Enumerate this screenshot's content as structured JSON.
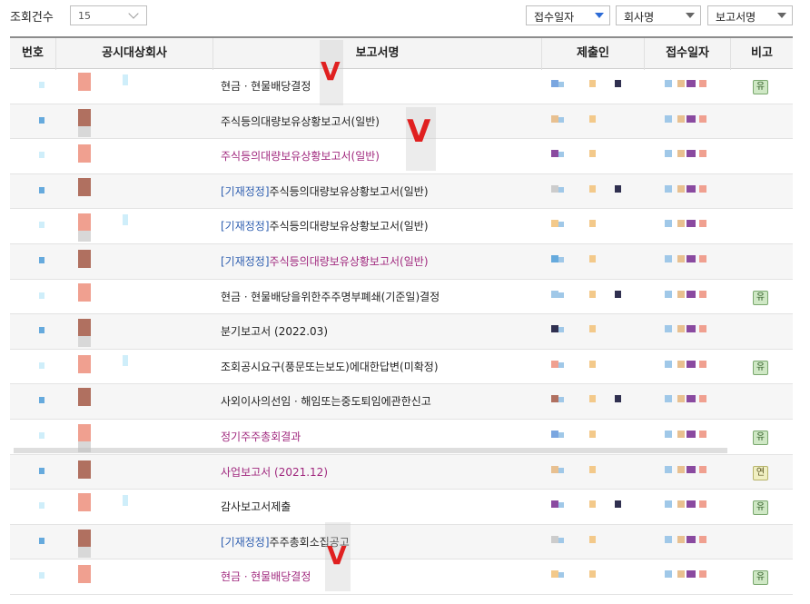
{
  "toolbar": {
    "count_label": "조회건수",
    "count_value": "15",
    "sort_receipt": "접수일자",
    "sort_company": "회사명",
    "sort_report": "보고서명"
  },
  "header": {
    "no": "번호",
    "company": "공시대상회사",
    "report": "보고서명",
    "submitter": "제출인",
    "date": "접수일자",
    "note": "비고"
  },
  "marks": [
    "V",
    "V",
    "V"
  ],
  "colors": {
    "purple_link": "#a0287e",
    "correction_blue": "#2f5fb0",
    "badge_green": "#cfe8c5",
    "badge_yellow": "#f0efc2",
    "mark_red": "#e02020"
  },
  "rows": [
    {
      "prefix": "",
      "title": "현금ㆍ현물배당결정",
      "style": "black",
      "badge": "유"
    },
    {
      "prefix": "",
      "title": "주식등의대량보유상황보고서(일반)",
      "style": "black",
      "badge": ""
    },
    {
      "prefix": "",
      "title": "주식등의대량보유상황보고서(일반)",
      "style": "purple",
      "badge": ""
    },
    {
      "prefix": "[기재정정]",
      "title": "주식등의대량보유상황보고서(일반)",
      "style": "black",
      "badge": ""
    },
    {
      "prefix": "[기재정정]",
      "title": "주식등의대량보유상황보고서(일반)",
      "style": "black",
      "badge": ""
    },
    {
      "prefix": "[기재정정]",
      "title": "주식등의대량보유상황보고서(일반)",
      "style": "purple",
      "badge": ""
    },
    {
      "prefix": "",
      "title": "현금ㆍ현물배당을위한주주명부폐쇄(기준일)결정",
      "style": "black",
      "badge": "유"
    },
    {
      "prefix": "",
      "title": "분기보고서 (2022.03)",
      "style": "black",
      "badge": ""
    },
    {
      "prefix": "",
      "title": "조회공시요구(풍문또는보도)에대한답변(미확정)",
      "style": "black",
      "badge": "유"
    },
    {
      "prefix": "",
      "title": "사외이사의선임ㆍ해임또는중도퇴임에관한신고",
      "style": "black",
      "badge": ""
    },
    {
      "prefix": "",
      "title": "정기주주총회결과",
      "style": "purple",
      "badge": "유"
    },
    {
      "prefix": "",
      "title": "사업보고서 (2021.12)",
      "style": "purple",
      "badge": "연"
    },
    {
      "prefix": "",
      "title": "감사보고서제출",
      "style": "black",
      "badge": "유"
    },
    {
      "prefix": "[기재정정]",
      "title": "주주총회소집공고",
      "style": "black",
      "badge": ""
    },
    {
      "prefix": "",
      "title": "현금ㆍ현물배당결정",
      "style": "purple",
      "badge": "유"
    }
  ]
}
